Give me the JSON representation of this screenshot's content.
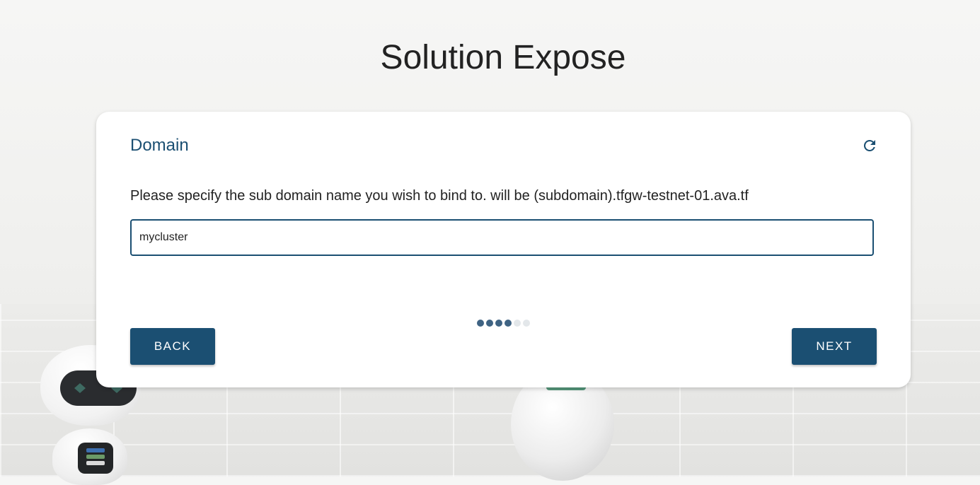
{
  "page": {
    "title": "Solution Expose"
  },
  "card": {
    "title": "Domain",
    "help_text": "Please specify the sub domain name you wish to bind to. will be (subdomain).tfgw-testnet-01.ava.tf",
    "subdomain_input": {
      "value": "mycluster",
      "placeholder": ""
    },
    "back_label": "BACK",
    "next_label": "NEXT",
    "steps": {
      "total": 6,
      "completed": 4
    }
  },
  "icons": {
    "refresh": "refresh-icon"
  },
  "colors": {
    "primary": "#1b4f72",
    "step_active": "#3f6383",
    "step_inactive": "#e3e7ea"
  }
}
